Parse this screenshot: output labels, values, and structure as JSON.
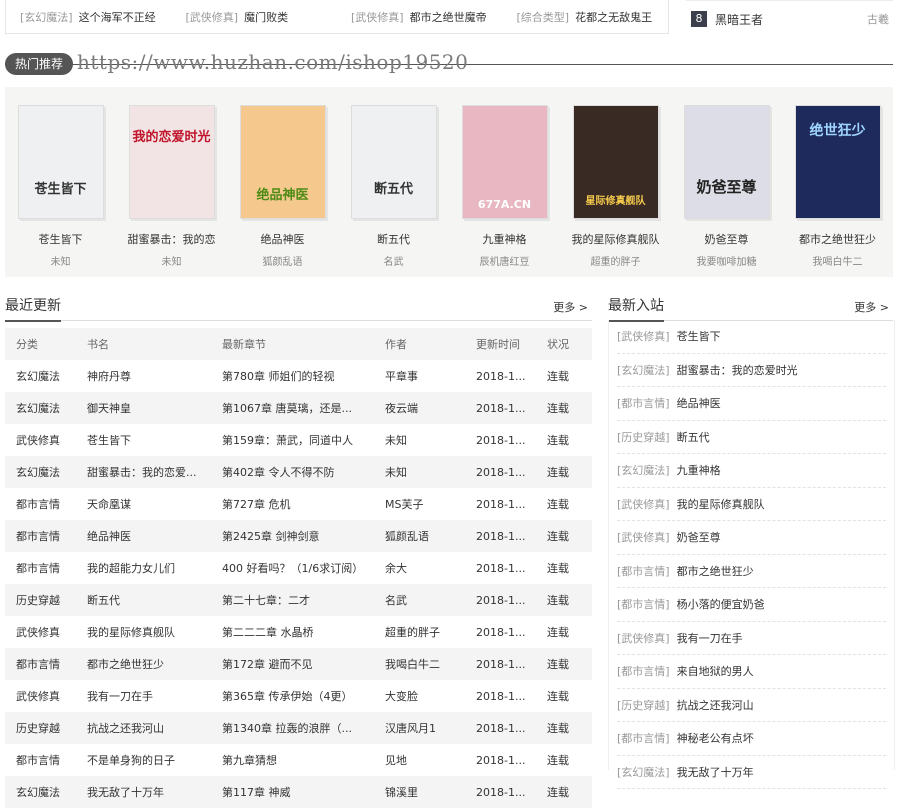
{
  "top_strip": [
    {
      "cat": "[玄幻魔法]",
      "title": "这个海军不正经"
    },
    {
      "cat": "[武侠修真]",
      "title": "魔门败类"
    },
    {
      "cat": "[武侠修真]",
      "title": "都市之绝世魔帝"
    },
    {
      "cat": "[综合类型]",
      "title": "花都之无敌鬼王"
    }
  ],
  "rank_item": {
    "rank": "8",
    "title": "黑暗王者",
    "author": "古羲"
  },
  "hot": {
    "label": "热门推荐",
    "watermark": "https://www.huzhan.com/ishop19520",
    "books": [
      {
        "title": "苍生皆下",
        "author": "未知",
        "cover_text": "苍生皆下",
        "bg": "#eef0f2",
        "fg": "#333"
      },
      {
        "title": "甜蜜暴击：我的恋",
        "author": "未知",
        "cover_text": "我的恋爱时光",
        "bg": "#f2e4e4",
        "fg": "#c0142b"
      },
      {
        "title": "绝品神医",
        "author": "狐颜乱语",
        "cover_text": "绝品神医",
        "bg": "#f5c98e",
        "fg": "#4f8b16"
      },
      {
        "title": "断五代",
        "author": "名武",
        "cover_text": "断五代",
        "bg": "#eef0f2",
        "fg": "#333"
      },
      {
        "title": "九重神格",
        "author": "辰机唐红豆",
        "cover_text": "677A.CN",
        "bg": "#e9b7c2",
        "fg": "#ffffff"
      },
      {
        "title": "我的星际修真舰队",
        "author": "超重的胖子",
        "cover_text": "星际修真舰队",
        "bg": "#3a2a24",
        "fg": "#f4c94c"
      },
      {
        "title": "奶爸至尊",
        "author": "我要咖啡加糖",
        "cover_text": "奶爸至尊",
        "bg": "#dcdde6",
        "fg": "#222"
      },
      {
        "title": "都市之绝世狂少",
        "author": "我喝白牛二",
        "cover_text": "绝世狂少",
        "bg": "#1e2a5c",
        "fg": "#9fd5ff"
      }
    ]
  },
  "recent": {
    "title": "最近更新",
    "more": "更多 >",
    "columns": [
      "分类",
      "书名",
      "最新章节",
      "作者",
      "更新时间",
      "状况"
    ],
    "rows": [
      [
        "玄幻魔法",
        "神府丹尊",
        "第780章 师姐们的轻视",
        "平章事",
        "2018-1...",
        "连载"
      ],
      [
        "玄幻魔法",
        "御天神皇",
        "第1067章 唐莫璃，还是...",
        "夜云端",
        "2018-1...",
        "连载"
      ],
      [
        "武侠修真",
        "苍生皆下",
        "第159章：萧武，同道中人",
        "未知",
        "2018-1...",
        "连载"
      ],
      [
        "玄幻魔法",
        "甜蜜暴击：我的恋爱...",
        "第402章 令人不得不防",
        "未知",
        "2018-1...",
        "连载"
      ],
      [
        "都市言情",
        "天命凰谋",
        "第727章 危机",
        "MS芙子",
        "2018-1...",
        "连载"
      ],
      [
        "都市言情",
        "绝品神医",
        "第2425章 剑神剑意",
        "狐颜乱语",
        "2018-1...",
        "连载"
      ],
      [
        "都市言情",
        "我的超能力女儿们",
        "400 好看吗？（1/6求订阅）",
        "余大",
        "2018-1...",
        "连载"
      ],
      [
        "历史穿越",
        "断五代",
        "第二十七章：二才",
        "名武",
        "2018-1...",
        "连载"
      ],
      [
        "武侠修真",
        "我的星际修真舰队",
        "第二二二章 水晶桥",
        "超重的胖子",
        "2018-1...",
        "连载"
      ],
      [
        "都市言情",
        "都市之绝世狂少",
        "第172章 避而不见",
        "我喝白牛二",
        "2018-1...",
        "连载"
      ],
      [
        "武侠修真",
        "我有一刀在手",
        "第365章 传承伊始（4更）",
        "大变脸",
        "2018-1...",
        "连载"
      ],
      [
        "历史穿越",
        "抗战之还我河山",
        "第1340章 拉轰的浪胖（...",
        "汉唐风月1",
        "2018-1...",
        "连载"
      ],
      [
        "都市言情",
        "不是单身狗的日子",
        "第九章猜想",
        "见地",
        "2018-1...",
        "连载"
      ],
      [
        "玄幻魔法",
        "我无敌了十万年",
        "第117章 神威",
        "锦溪里",
        "2018-1...",
        "连载"
      ]
    ]
  },
  "new_entries": {
    "title": "最新入站",
    "more": "更多 >",
    "items": [
      {
        "cat": "[武侠修真]",
        "title": "苍生皆下"
      },
      {
        "cat": "[玄幻魔法]",
        "title": "甜蜜暴击：我的恋爱时光"
      },
      {
        "cat": "[都市言情]",
        "title": "绝品神医"
      },
      {
        "cat": "[历史穿越]",
        "title": "断五代"
      },
      {
        "cat": "[玄幻魔法]",
        "title": "九重神格"
      },
      {
        "cat": "[武侠修真]",
        "title": "我的星际修真舰队"
      },
      {
        "cat": "[武侠修真]",
        "title": "奶爸至尊"
      },
      {
        "cat": "[都市言情]",
        "title": "都市之绝世狂少"
      },
      {
        "cat": "[都市言情]",
        "title": "杨小落的便宜奶爸"
      },
      {
        "cat": "[武侠修真]",
        "title": "我有一刀在手"
      },
      {
        "cat": "[都市言情]",
        "title": "来自地狱的男人"
      },
      {
        "cat": "[历史穿越]",
        "title": "抗战之还我河山"
      },
      {
        "cat": "[都市言情]",
        "title": "神秘老公有点坏"
      },
      {
        "cat": "[玄幻魔法]",
        "title": "我无敌了十万年"
      }
    ]
  }
}
